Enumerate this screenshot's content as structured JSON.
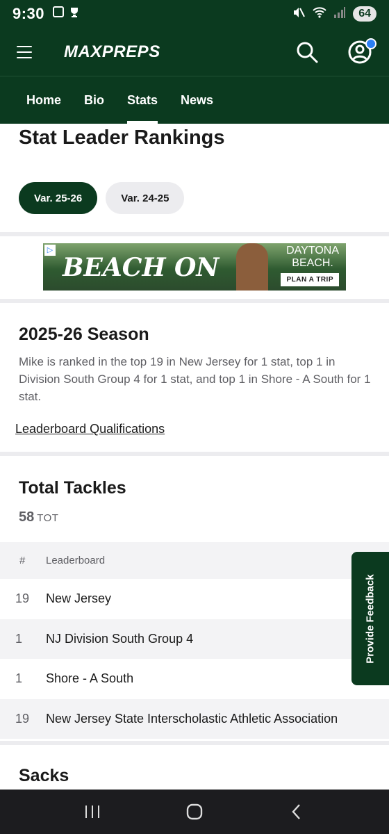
{
  "status_bar": {
    "time": "9:30",
    "battery": "64"
  },
  "app": {
    "logo": "MAXPREPS",
    "tabs": [
      {
        "label": "Home"
      },
      {
        "label": "Bio"
      },
      {
        "label": "Stats"
      },
      {
        "label": "News"
      }
    ],
    "active_tab": "Stats"
  },
  "page": {
    "title": "Stat Leader Rankings",
    "seasons": [
      {
        "label": "Var. 25-26",
        "active": true
      },
      {
        "label": "Var. 24-25",
        "active": false
      }
    ]
  },
  "ad": {
    "headline": "BEACH ON",
    "brand_line1": "DAYTONA",
    "brand_line2": "BEACH.",
    "cta": "PLAN A TRIP"
  },
  "season_summary": {
    "title": "2025-26 Season",
    "description": "Mike is ranked in the top 19 in New Jersey for 1 stat, top 1 in Division South Group 4 for 1 stat, and top 1 in Shore - A South for 1 stat.",
    "qualifications_link": "Leaderboard Qualifications"
  },
  "stat": {
    "title": "Total Tackles",
    "value": "58",
    "unit": "TOT",
    "table": {
      "headers": {
        "rank": "#",
        "name": "Leaderboard"
      },
      "rows": [
        {
          "rank": "19",
          "name": "New Jersey"
        },
        {
          "rank": "1",
          "name": "NJ Division South Group 4"
        },
        {
          "rank": "1",
          "name": "Shore - A South"
        },
        {
          "rank": "19",
          "name": "New Jersey State Interscholastic Athletic Association"
        }
      ]
    }
  },
  "next_stat": {
    "title": "Sacks"
  },
  "feedback": {
    "label": "Provide Feedback"
  },
  "colors": {
    "brand_green": "#0b3a1f",
    "chip_inactive": "#ececef",
    "muted_text": "#5f5f64",
    "notify_blue": "#2b7ff3"
  }
}
